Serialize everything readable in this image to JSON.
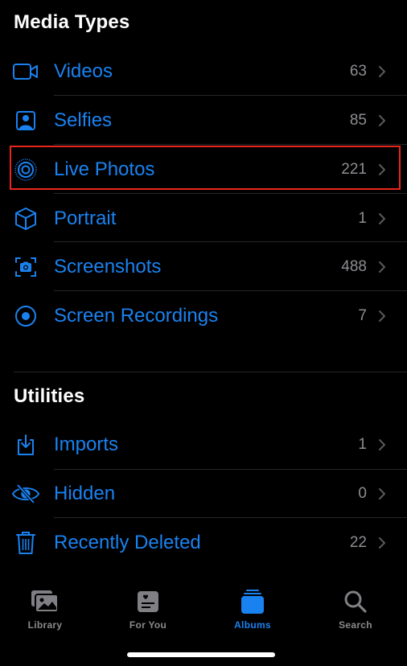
{
  "sections": [
    {
      "title": "Media Types",
      "items": [
        {
          "label": "Videos",
          "count": "63",
          "icon": "video-camera-icon"
        },
        {
          "label": "Selfies",
          "count": "85",
          "icon": "selfie-portrait-icon"
        },
        {
          "label": "Live Photos",
          "count": "221",
          "icon": "live-photo-icon",
          "highlighted": true
        },
        {
          "label": "Portrait",
          "count": "1",
          "icon": "cube-icon"
        },
        {
          "label": "Screenshots",
          "count": "488",
          "icon": "screenshot-camera-icon"
        },
        {
          "label": "Screen Recordings",
          "count": "7",
          "icon": "record-circle-icon"
        }
      ]
    },
    {
      "title": "Utilities",
      "items": [
        {
          "label": "Imports",
          "count": "1",
          "icon": "import-tray-icon"
        },
        {
          "label": "Hidden",
          "count": "0",
          "icon": "eye-slash-icon"
        },
        {
          "label": "Recently Deleted",
          "count": "22",
          "icon": "trash-icon"
        }
      ]
    }
  ],
  "tabbar": {
    "tabs": [
      {
        "label": "Library",
        "icon": "photo-library-icon",
        "active": false
      },
      {
        "label": "For You",
        "icon": "for-you-card-icon",
        "active": false
      },
      {
        "label": "Albums",
        "icon": "albums-stack-icon",
        "active": true
      },
      {
        "label": "Search",
        "icon": "search-icon",
        "active": false
      }
    ]
  },
  "colors": {
    "accent": "#1a82f0",
    "highlight_border": "#e8261c",
    "secondary_text": "#8d8d92",
    "background": "#000000"
  }
}
